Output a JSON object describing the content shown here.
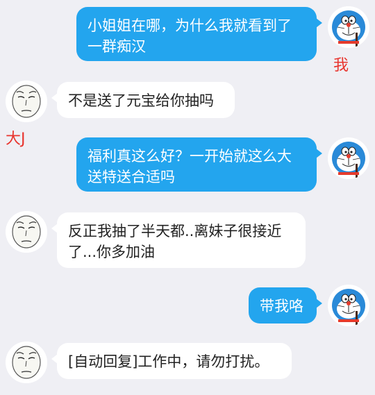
{
  "conversation": {
    "labels": {
      "me": "我",
      "other": "大J"
    },
    "colors": {
      "me_bubble": "#23a5ee",
      "other_bubble": "#ffffff",
      "background": "#efeff4",
      "label_red": "#e8352e"
    },
    "avatars": {
      "me": "doraemon-avatar",
      "other": "meme-face-avatar"
    },
    "messages": [
      {
        "sender": "me",
        "text": "小姐姐在哪，为什么我就看到了一群痴汉"
      },
      {
        "sender": "other",
        "text": "不是送了元宝给你抽吗"
      },
      {
        "sender": "me",
        "text": "福利真这么好？一开始就这么大送特送合适吗"
      },
      {
        "sender": "other",
        "text": "反正我抽了半天都..离妹子很接近了...你多加油"
      },
      {
        "sender": "me",
        "text": "带我咯"
      },
      {
        "sender": "other",
        "text": "[自动回复]工作中，请勿打扰。"
      }
    ]
  }
}
